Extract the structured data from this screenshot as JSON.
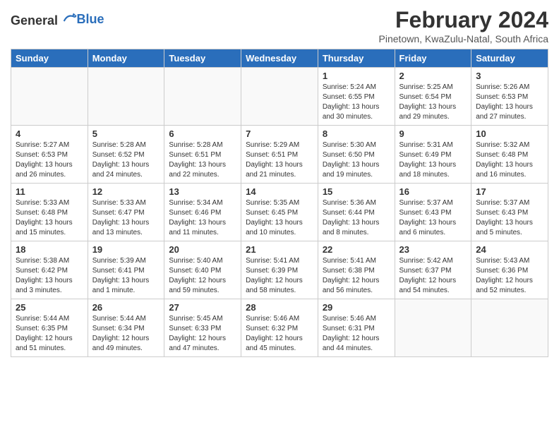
{
  "logo": {
    "general": "General",
    "blue": "Blue"
  },
  "title": "February 2024",
  "location": "Pinetown, KwaZulu-Natal, South Africa",
  "headers": [
    "Sunday",
    "Monday",
    "Tuesday",
    "Wednesday",
    "Thursday",
    "Friday",
    "Saturday"
  ],
  "weeks": [
    [
      {
        "day": "",
        "info": ""
      },
      {
        "day": "",
        "info": ""
      },
      {
        "day": "",
        "info": ""
      },
      {
        "day": "",
        "info": ""
      },
      {
        "day": "1",
        "info": "Sunrise: 5:24 AM\nSunset: 6:55 PM\nDaylight: 13 hours\nand 30 minutes."
      },
      {
        "day": "2",
        "info": "Sunrise: 5:25 AM\nSunset: 6:54 PM\nDaylight: 13 hours\nand 29 minutes."
      },
      {
        "day": "3",
        "info": "Sunrise: 5:26 AM\nSunset: 6:53 PM\nDaylight: 13 hours\nand 27 minutes."
      }
    ],
    [
      {
        "day": "4",
        "info": "Sunrise: 5:27 AM\nSunset: 6:53 PM\nDaylight: 13 hours\nand 26 minutes."
      },
      {
        "day": "5",
        "info": "Sunrise: 5:28 AM\nSunset: 6:52 PM\nDaylight: 13 hours\nand 24 minutes."
      },
      {
        "day": "6",
        "info": "Sunrise: 5:28 AM\nSunset: 6:51 PM\nDaylight: 13 hours\nand 22 minutes."
      },
      {
        "day": "7",
        "info": "Sunrise: 5:29 AM\nSunset: 6:51 PM\nDaylight: 13 hours\nand 21 minutes."
      },
      {
        "day": "8",
        "info": "Sunrise: 5:30 AM\nSunset: 6:50 PM\nDaylight: 13 hours\nand 19 minutes."
      },
      {
        "day": "9",
        "info": "Sunrise: 5:31 AM\nSunset: 6:49 PM\nDaylight: 13 hours\nand 18 minutes."
      },
      {
        "day": "10",
        "info": "Sunrise: 5:32 AM\nSunset: 6:48 PM\nDaylight: 13 hours\nand 16 minutes."
      }
    ],
    [
      {
        "day": "11",
        "info": "Sunrise: 5:33 AM\nSunset: 6:48 PM\nDaylight: 13 hours\nand 15 minutes."
      },
      {
        "day": "12",
        "info": "Sunrise: 5:33 AM\nSunset: 6:47 PM\nDaylight: 13 hours\nand 13 minutes."
      },
      {
        "day": "13",
        "info": "Sunrise: 5:34 AM\nSunset: 6:46 PM\nDaylight: 13 hours\nand 11 minutes."
      },
      {
        "day": "14",
        "info": "Sunrise: 5:35 AM\nSunset: 6:45 PM\nDaylight: 13 hours\nand 10 minutes."
      },
      {
        "day": "15",
        "info": "Sunrise: 5:36 AM\nSunset: 6:44 PM\nDaylight: 13 hours\nand 8 minutes."
      },
      {
        "day": "16",
        "info": "Sunrise: 5:37 AM\nSunset: 6:43 PM\nDaylight: 13 hours\nand 6 minutes."
      },
      {
        "day": "17",
        "info": "Sunrise: 5:37 AM\nSunset: 6:43 PM\nDaylight: 13 hours\nand 5 minutes."
      }
    ],
    [
      {
        "day": "18",
        "info": "Sunrise: 5:38 AM\nSunset: 6:42 PM\nDaylight: 13 hours\nand 3 minutes."
      },
      {
        "day": "19",
        "info": "Sunrise: 5:39 AM\nSunset: 6:41 PM\nDaylight: 13 hours\nand 1 minute."
      },
      {
        "day": "20",
        "info": "Sunrise: 5:40 AM\nSunset: 6:40 PM\nDaylight: 12 hours\nand 59 minutes."
      },
      {
        "day": "21",
        "info": "Sunrise: 5:41 AM\nSunset: 6:39 PM\nDaylight: 12 hours\nand 58 minutes."
      },
      {
        "day": "22",
        "info": "Sunrise: 5:41 AM\nSunset: 6:38 PM\nDaylight: 12 hours\nand 56 minutes."
      },
      {
        "day": "23",
        "info": "Sunrise: 5:42 AM\nSunset: 6:37 PM\nDaylight: 12 hours\nand 54 minutes."
      },
      {
        "day": "24",
        "info": "Sunrise: 5:43 AM\nSunset: 6:36 PM\nDaylight: 12 hours\nand 52 minutes."
      }
    ],
    [
      {
        "day": "25",
        "info": "Sunrise: 5:44 AM\nSunset: 6:35 PM\nDaylight: 12 hours\nand 51 minutes."
      },
      {
        "day": "26",
        "info": "Sunrise: 5:44 AM\nSunset: 6:34 PM\nDaylight: 12 hours\nand 49 minutes."
      },
      {
        "day": "27",
        "info": "Sunrise: 5:45 AM\nSunset: 6:33 PM\nDaylight: 12 hours\nand 47 minutes."
      },
      {
        "day": "28",
        "info": "Sunrise: 5:46 AM\nSunset: 6:32 PM\nDaylight: 12 hours\nand 45 minutes."
      },
      {
        "day": "29",
        "info": "Sunrise: 5:46 AM\nSunset: 6:31 PM\nDaylight: 12 hours\nand 44 minutes."
      },
      {
        "day": "",
        "info": ""
      },
      {
        "day": "",
        "info": ""
      }
    ]
  ]
}
